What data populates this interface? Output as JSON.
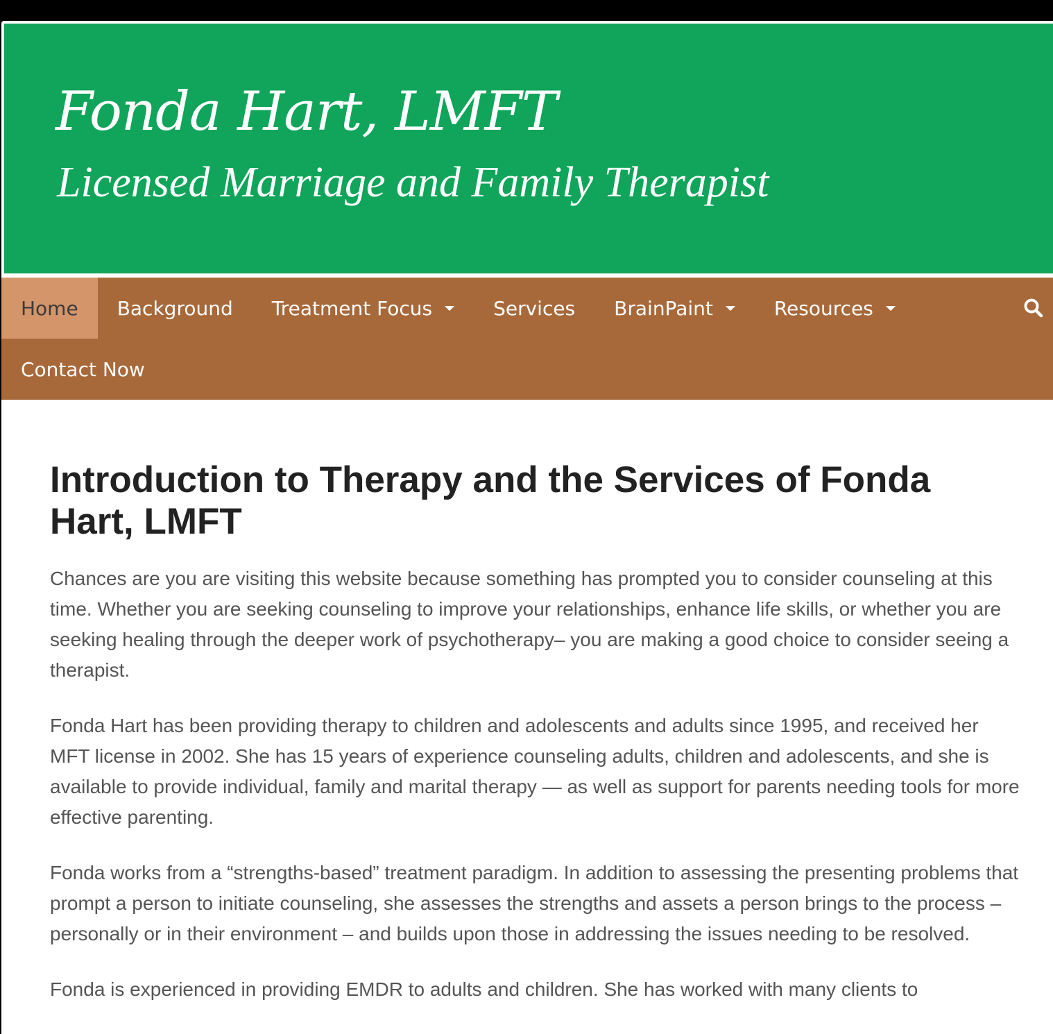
{
  "header": {
    "title": "Fonda Hart, LMFT",
    "tagline": "Licensed Marriage and Family Therapist"
  },
  "nav": {
    "items": [
      {
        "label": "Home",
        "active": true,
        "dropdown": false
      },
      {
        "label": "Background",
        "dropdown": false
      },
      {
        "label": "Treatment Focus",
        "dropdown": true
      },
      {
        "label": "Services",
        "dropdown": false
      },
      {
        "label": "BrainPaint",
        "dropdown": true
      },
      {
        "label": "Resources",
        "dropdown": true
      },
      {
        "label": "Contact Now",
        "dropdown": false
      }
    ],
    "search_icon": "search-icon"
  },
  "main": {
    "title": "Introduction to Therapy and the Services of Fonda Hart, LMFT",
    "paragraphs": [
      "Chances are you are visiting this website because something has prompted you to consider counseling at this time. Whether you are seeking counseling to improve your relationships, enhance life skills, or whether you are seeking healing through the deeper work of psychotherapy– you are making a good choice to consider seeing a therapist.",
      "Fonda Hart has been providing therapy to children and adolescents and adults since 1995, and received her MFT license in 2002. She has 15 years of experience counseling adults, children and adolescents, and she is available to provide individual, family and marital therapy — as well as support for parents needing tools for more effective parenting.",
      "Fonda works from a “strengths-based” treatment paradigm. In addition to assessing the presenting problems that prompt a person to initiate counseling, she assesses the strengths and assets a person brings to the process – personally or in their environment – and builds upon those in addressing the issues needing to be resolved.",
      "Fonda is experienced in providing EMDR to adults and children. She has worked with many clients to"
    ]
  },
  "colors": {
    "header_bg": "#10a55a",
    "nav_bg": "#a8693a",
    "nav_active_bg": "#d4956a",
    "title_text": "#222222",
    "body_text": "#555555"
  }
}
